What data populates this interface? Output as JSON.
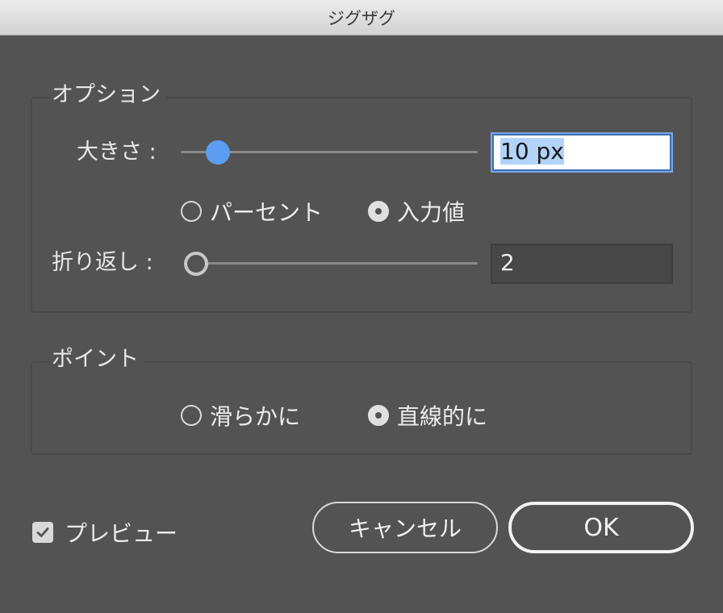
{
  "window": {
    "title": "ジグザグ"
  },
  "options": {
    "label": "オプション",
    "size": {
      "label": "大きさ :",
      "value": "10 px"
    },
    "units": [
      {
        "label": "パーセント",
        "selected": false
      },
      {
        "label": "入力値",
        "selected": true
      }
    ],
    "ridges": {
      "label": "折り返し :",
      "value": "2"
    }
  },
  "points": {
    "label": "ポイント",
    "choices": [
      {
        "label": "滑らかに",
        "selected": false
      },
      {
        "label": "直線的に",
        "selected": true
      }
    ]
  },
  "preview": {
    "label": "プレビュー",
    "checked": true
  },
  "buttons": {
    "cancel": "キャンセル",
    "ok": "OK"
  },
  "colors": {
    "accent": "#5b9df0",
    "background": "#535353"
  }
}
